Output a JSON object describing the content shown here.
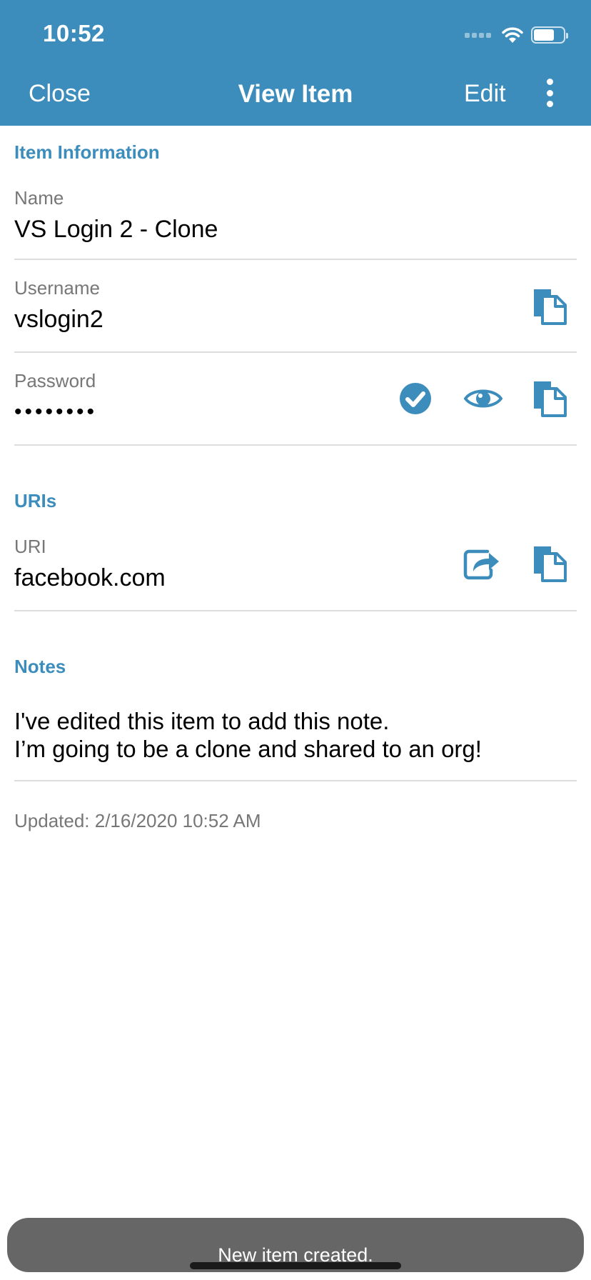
{
  "status_bar": {
    "time": "10:52"
  },
  "nav": {
    "close_label": "Close",
    "title": "View Item",
    "edit_label": "Edit",
    "more_icon": "more-vertical-icon"
  },
  "item_information": {
    "section_title": "Item Information",
    "name": {
      "label": "Name",
      "value": "VS Login 2 - Clone"
    },
    "username": {
      "label": "Username",
      "value": "vslogin2",
      "copy_icon": "copy-icon"
    },
    "password": {
      "label": "Password",
      "value": "••••••••",
      "check_icon": "check-circle-icon",
      "toggle_icon": "eye-icon",
      "copy_icon": "copy-icon"
    }
  },
  "uris": {
    "section_title": "URIs",
    "uri": {
      "label": "URI",
      "value": "facebook.com",
      "launch_icon": "share-icon",
      "copy_icon": "copy-icon"
    }
  },
  "notes": {
    "section_title": "Notes",
    "lines": [
      "I've edited this item to add this note.",
      "I’m going to be a clone and shared to an org!"
    ]
  },
  "updated_text": "Updated: 2/16/2020 10:52 AM",
  "toast": {
    "message": "New item created."
  },
  "colors": {
    "accent": "#3c8dbc",
    "label": "#777777",
    "divider": "#dddddd",
    "toast_bg": "#666666"
  }
}
